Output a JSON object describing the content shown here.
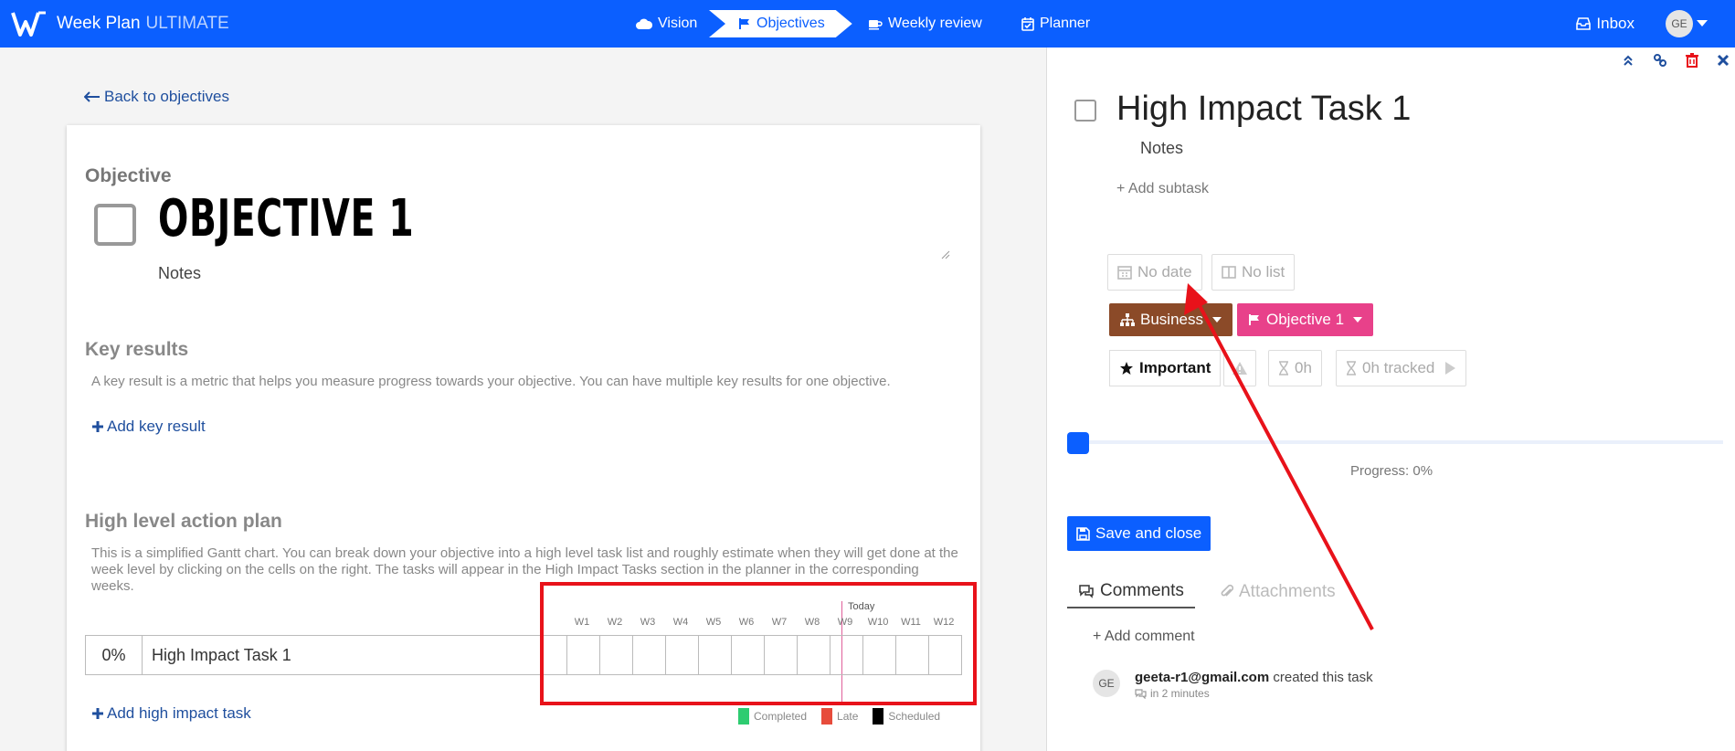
{
  "app": {
    "brand": "Week Plan",
    "brand_suffix": "ULTIMATE"
  },
  "nav": {
    "vision": "Vision",
    "objectives": "Objectives",
    "weekly_review": "Weekly review",
    "planner": "Planner",
    "inbox": "Inbox",
    "user_initials": "GE"
  },
  "left": {
    "back": "Back to objectives",
    "objective_label": "Objective",
    "objective_title": "OBJECTIVE 1",
    "objective_notes": "Notes",
    "key_results_label": "Key results",
    "key_results_desc": "A key result is a metric that helps you measure progress towards your objective. You can have multiple key results for one objective.",
    "add_key_result": "Add key result",
    "plan_label": "High level action plan",
    "plan_desc": "This is a simplified Gantt chart. You can break down your objective into a high level task list and roughly estimate when they will get done at the week level by clicking on the cells on the right. The tasks will appear in the High Impact Tasks section in the planner in the corresponding weeks.",
    "today": "Today",
    "weeks": [
      "W1",
      "W2",
      "W3",
      "W4",
      "W5",
      "W6",
      "W7",
      "W8",
      "W9",
      "W10",
      "W11",
      "W12"
    ],
    "task_row": {
      "progress": "0%",
      "name": "High Impact Task 1"
    },
    "add_task": "Add high impact task",
    "legend": [
      {
        "label": "Completed",
        "color": "#2ecc71"
      },
      {
        "label": "Late",
        "color": "#e74c3c"
      },
      {
        "label": "Scheduled",
        "color": "#000000"
      }
    ]
  },
  "right": {
    "task_title": "High Impact Task 1",
    "notes": "Notes",
    "add_subtask": "+ Add subtask",
    "no_date": "No date",
    "no_list": "No list",
    "area": "Business",
    "objective": "Objective 1",
    "important": "Important",
    "estimate": "0h",
    "tracked": "0h tracked",
    "progress_value": 0,
    "progress_text": "Progress: 0%",
    "save": "Save and close",
    "tab_comments": "Comments",
    "tab_attachments": "Attachments",
    "add_comment": "+ Add comment",
    "comment_initials": "GE",
    "comment_user": "geeta-r1@gmail.com",
    "comment_action": "created this task",
    "comment_time": "in 2 minutes"
  },
  "colors": {
    "primary": "#0b5fff",
    "business": "#8b4a28",
    "objective": "#e8418a",
    "annotation": "#e8121a"
  }
}
